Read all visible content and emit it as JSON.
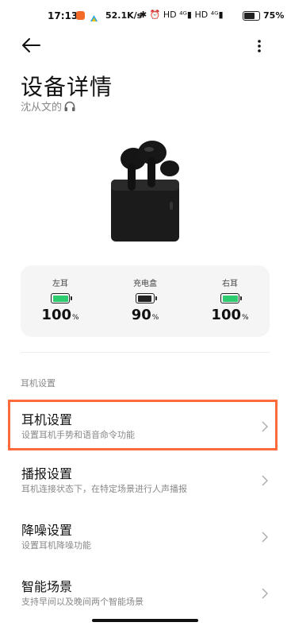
{
  "status_bar": {
    "time": "17:13",
    "speed": "52.1K/s",
    "icons_text": "✱ ⏰ HD ⁴ᴳ▮ HD ⁴ᴳ▮",
    "battery_percent": "75",
    "battery_level": 0.75
  },
  "header": {
    "back_icon": "arrow-left-icon",
    "more_icon": "vertical-dots-icon"
  },
  "page": {
    "title": "设备详情",
    "owner_name": "沈从文的",
    "owner_icon": "headphone-icon"
  },
  "battery": [
    {
      "label": "左耳",
      "value": "100",
      "unit": "%",
      "level": 1.0,
      "color": "#2ecc71"
    },
    {
      "label": "充电盒",
      "value": "90",
      "unit": "%",
      "level": 0.9,
      "color": "#222222"
    },
    {
      "label": "右耳",
      "value": "100",
      "unit": "%",
      "level": 1.0,
      "color": "#2ecc71"
    }
  ],
  "section": {
    "title": "耳机设置"
  },
  "items": [
    {
      "title": "耳机设置",
      "desc": "设置耳机手势和语音命令功能"
    },
    {
      "title": "播报设置",
      "desc": "耳机连接状态下，在特定场景进行人声播报"
    },
    {
      "title": "降噪设置",
      "desc": "设置耳机降噪功能"
    },
    {
      "title": "智能场景",
      "desc": "支持早间以及晚间两个智能场景"
    }
  ],
  "colors": {
    "highlight": "#ff6a3d",
    "battery_green": "#2ecc71",
    "card_bg": "#f5f5f5"
  }
}
